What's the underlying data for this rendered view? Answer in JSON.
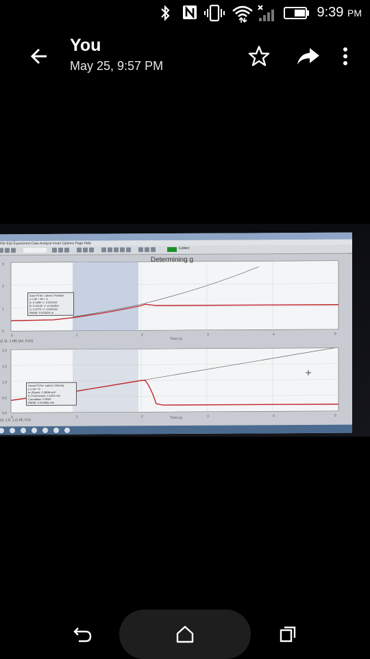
{
  "status_bar": {
    "time": "9:39",
    "time_suffix": "PM",
    "icons": [
      "bluetooth-icon",
      "nfc-icon",
      "vibrate-icon",
      "wifi-icon",
      "cell-signal-icon",
      "battery-icon"
    ]
  },
  "header": {
    "title": "You",
    "subtitle": "May 25, 9:57 PM",
    "actions": [
      "back-icon",
      "star-icon",
      "share-icon",
      "more-icon"
    ]
  },
  "photo": {
    "graph_title": "Determining g",
    "toolbar_collect_label": "Collect",
    "top_axis_label": "Time (s)",
    "bottom_axis_label": "Time (s)",
    "top_readout": "(2.11, 1.06) (Δx: 0.01)",
    "bottom_readout": "(Δ: 1.0...) (1.05, 0.0)",
    "top_stat_lines": [
      "Auto Fit for: Latest | Position",
      "x = At² + Bt + C",
      "A: 0.1185 +/- 0.002152",
      "B: 0.01125 +/- 0.004454",
      "C: 0.3772 +/- 0.002154",
      "RMSE: 0.003424 m"
    ],
    "bottom_stat_lines": [
      "Linear Fit for: Latest | Velocity",
      "y = mt + b",
      "m (Slope): 0.2898 m/s²",
      "b (Y-intercept): 0.4223 m/s",
      "Correlation: 0.9997",
      "RMSE: 0.004484 m/s"
    ],
    "top_y_ticks": [
      "3",
      "2",
      "1",
      "0"
    ],
    "top_x_ticks": [
      "0",
      "1",
      "2",
      "3",
      "4",
      "5"
    ],
    "bottom_y_ticks": [
      "2.0",
      "1.5",
      "1.0",
      "0.5",
      "0.0"
    ],
    "bottom_x_ticks": [
      "0",
      "1",
      "2",
      "3",
      "4",
      "5"
    ]
  },
  "nav": {
    "back_label": "back",
    "home_label": "home",
    "recents_label": "recents"
  }
}
